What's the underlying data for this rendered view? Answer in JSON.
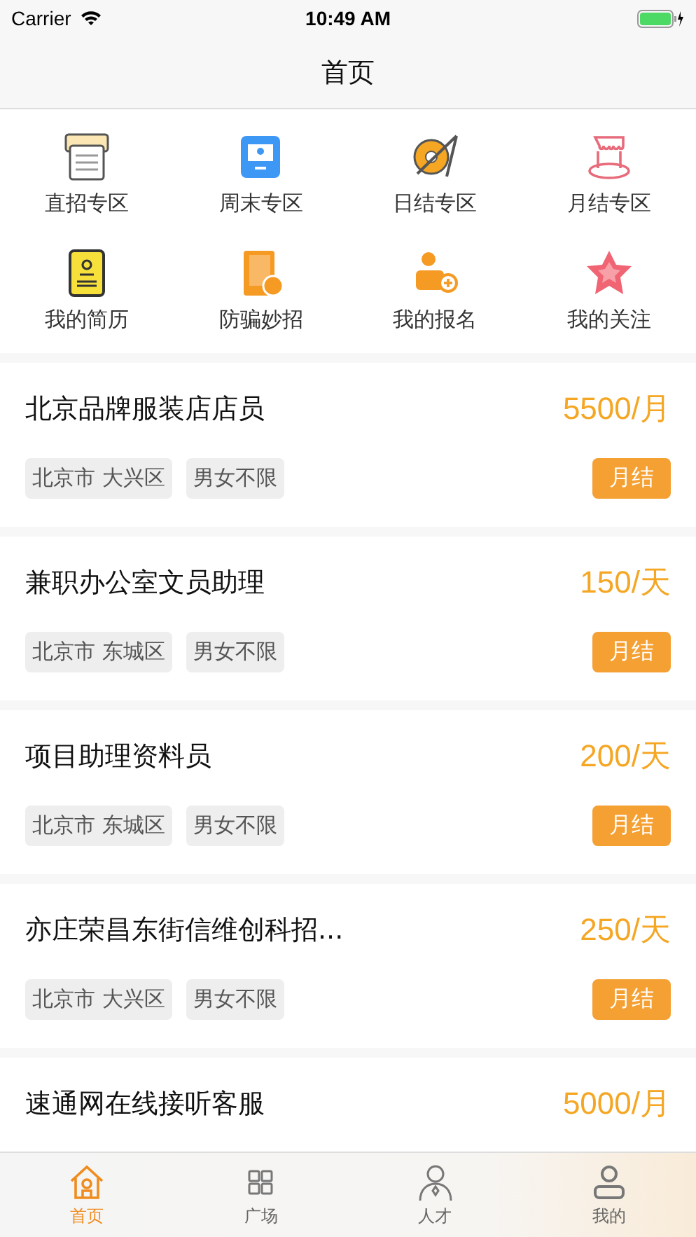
{
  "status_bar": {
    "carrier": "Carrier",
    "time": "10:49 AM"
  },
  "nav": {
    "title": "首页"
  },
  "categories": [
    {
      "label": "直招专区",
      "kind": "printer"
    },
    {
      "label": "周末专区",
      "kind": "monitor"
    },
    {
      "label": "日结专区",
      "kind": "compass"
    },
    {
      "label": "月结专区",
      "kind": "stand"
    },
    {
      "label": "我的简历",
      "kind": "resume"
    },
    {
      "label": "防骗妙招",
      "kind": "book"
    },
    {
      "label": "我的报名",
      "kind": "signup"
    },
    {
      "label": "我的关注",
      "kind": "star"
    }
  ],
  "jobs": [
    {
      "title": "北京品牌服装店店员",
      "salary": "5500/月",
      "tags": [
        "北京市 大兴区",
        "男女不限"
      ],
      "badge": "月结"
    },
    {
      "title": "兼职办公室文员助理",
      "salary": "150/天",
      "tags": [
        "北京市 东城区",
        "男女不限"
      ],
      "badge": "月结"
    },
    {
      "title": "项目助理资料员",
      "salary": "200/天",
      "tags": [
        "北京市 东城区",
        "男女不限"
      ],
      "badge": "月结"
    },
    {
      "title": "亦庄荣昌东街信维创科招...",
      "salary": "250/天",
      "tags": [
        "北京市 大兴区",
        "男女不限"
      ],
      "badge": "月结"
    },
    {
      "title": "速通网在线接听客服",
      "salary": "5000/月"
    }
  ],
  "tab_bar": [
    {
      "label": "首页",
      "kind": "home",
      "selected": true
    },
    {
      "label": "广场",
      "kind": "grid",
      "selected": false
    },
    {
      "label": "人才",
      "kind": "person",
      "selected": false
    },
    {
      "label": "我的",
      "kind": "profile",
      "selected": false
    }
  ]
}
